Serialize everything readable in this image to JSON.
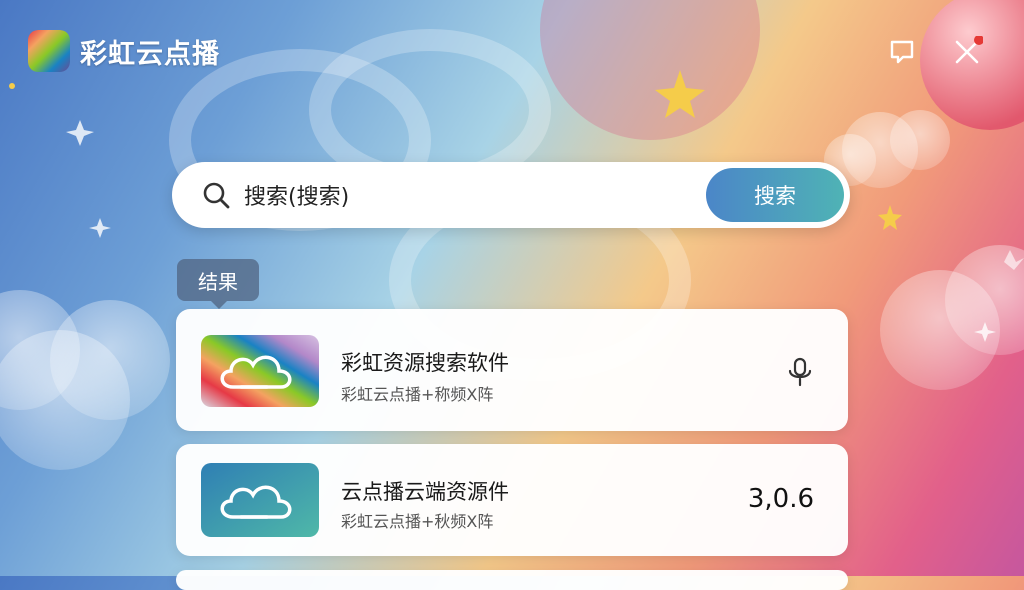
{
  "app": {
    "title": "彩虹云点播"
  },
  "search": {
    "value": "搜索(搜索)",
    "button_label": "搜索"
  },
  "results": {
    "label": "结果",
    "items": [
      {
        "title": "彩虹资源搜索软件",
        "subtitle": "彩虹云点播+称频X阵",
        "right_icon": "microphone-icon"
      },
      {
        "title": "云点播云端资源件",
        "subtitle": "彩虹云点播+秋频X阵",
        "version": "3,0.6"
      }
    ]
  },
  "icons": {
    "top_right": [
      "feedback-icon",
      "close-icon"
    ]
  }
}
